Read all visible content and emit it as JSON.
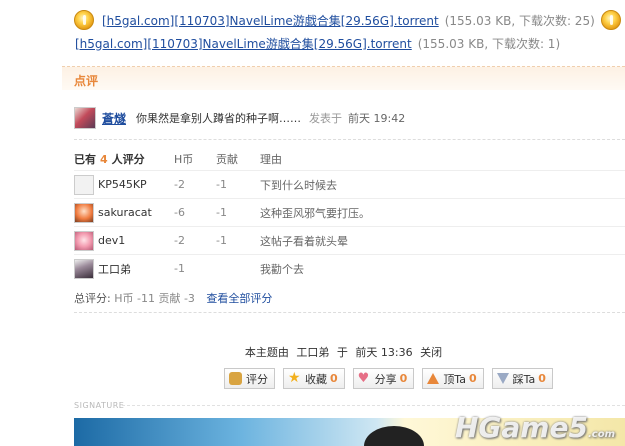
{
  "attachments": [
    {
      "name": "[h5gal.com][110703]NavelLime游戯合集[29.56G].torrent",
      "meta": "(155.03 KB, 下载次数: 25)"
    },
    {
      "name": "[h5gal.com][110703]NavelLime游戯合集[29.56G].torrent",
      "meta": "(155.03 KB, 下载次数: 1)"
    }
  ],
  "rate_section": {
    "title": "点评"
  },
  "comment": {
    "user": "蒼燧",
    "text": "你果然是拿别人蹲省的种子啊……",
    "posted_label": "发表于",
    "time": "前天 19:42"
  },
  "ratings": {
    "header": {
      "prefix": "已有",
      "count": "4",
      "suffix": "人评分",
      "col_h": "H币",
      "col_g": "贡献",
      "col_r": "理由"
    },
    "rows": [
      {
        "user": "KP545KP",
        "h": "-2",
        "g": "-1",
        "reason": "下到什么时候去"
      },
      {
        "user": "sakuracat",
        "h": "-6",
        "g": "-1",
        "reason": "这种歪风邪气要打压。"
      },
      {
        "user": "dev1",
        "h": "-2",
        "g": "-1",
        "reason": "这帖子看着就头晕"
      },
      {
        "user": "工口弟",
        "h": "-1",
        "g": "",
        "reason": "我勸个去"
      }
    ],
    "summary": {
      "label": "总评分:",
      "h": "H币 -11",
      "g": "贡献 -3",
      "link": "查看全部评分"
    }
  },
  "closed_notice": {
    "prefix": "本主题由",
    "user": "工口弟",
    "mid": "于",
    "time": "前天 13:36",
    "action": "关闭"
  },
  "actions": [
    {
      "label": "评分",
      "count": "",
      "icon": "rate-icon"
    },
    {
      "label": "收藏",
      "count": "0",
      "icon": "star-icon"
    },
    {
      "label": "分享",
      "count": "0",
      "icon": "heart-icon"
    },
    {
      "label": "顶Ta",
      "count": "0",
      "icon": "thumb-up-icon"
    },
    {
      "label": "踩Ta",
      "count": "0",
      "icon": "thumb-down-icon"
    }
  ],
  "signature": {
    "label": "SIGNATURE",
    "watermark": "HGame5",
    "watermark_suffix": ".com"
  },
  "colors": {
    "link": "#1f4d9e",
    "accent": "#e8873a"
  }
}
